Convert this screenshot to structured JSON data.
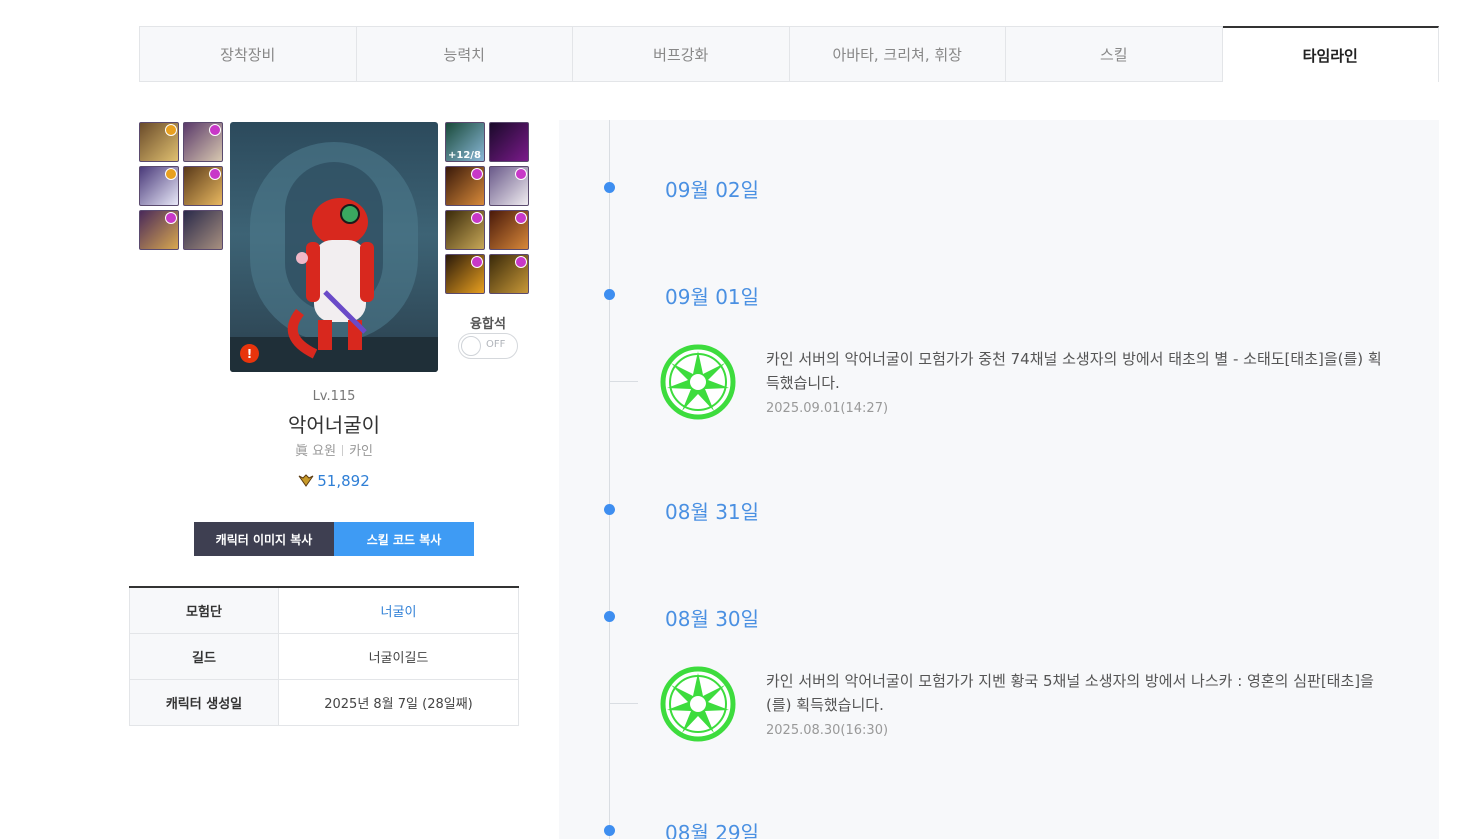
{
  "tabs": [
    {
      "label": "장착장비",
      "active": false
    },
    {
      "label": "능력치",
      "active": false
    },
    {
      "label": "버프강화",
      "active": false
    },
    {
      "label": "아바타, 크리쳐, 휘장",
      "active": false
    },
    {
      "label": "스킬",
      "active": false
    },
    {
      "label": "타임라인",
      "active": true
    }
  ],
  "equipment": {
    "right_top_badge": "+12/8"
  },
  "fusion": {
    "label": "융합석",
    "toggle_state": "OFF"
  },
  "character": {
    "level": "Lv.115",
    "name": "악어너굴이",
    "job": "眞 요원",
    "server": "카인",
    "popularity": "51,892",
    "alert": "!"
  },
  "buttons": {
    "copy_image": "캐릭터 이미지 복사",
    "copy_skill_code": "스킬 코드 복사"
  },
  "info": {
    "adventure_label": "모험단",
    "adventure_value": "너굴이",
    "guild_label": "길드",
    "guild_value": "너굴이길드",
    "created_label": "캐릭터 생성일",
    "created_value": "2025년 8월 7일 (28일째)"
  },
  "timeline": {
    "dates": [
      "09월 02일",
      "09월 01일",
      "08월 31일",
      "08월 30일",
      "08월 29일"
    ],
    "entries": [
      {
        "text": "카인 서버의 악어너굴이 모험가가 중천 74채널 소생자의 방에서 태초의 별 - 소태도[태초]을(를) 획득했습니다.",
        "time": "2025.09.01(14:27)"
      },
      {
        "text": "카인 서버의 악어너굴이 모험가가 지벤 황국 5채널 소생자의 방에서 나스카 : 영혼의 심판[태초]을(를) 획득했습니다.",
        "time": "2025.08.30(16:30)"
      }
    ]
  },
  "colors": {
    "accent_blue": "#3e9bf4",
    "timeline_blue": "#4a90e2",
    "dark_button": "#3e3f51",
    "primeval_green": "#3ddc3d"
  }
}
